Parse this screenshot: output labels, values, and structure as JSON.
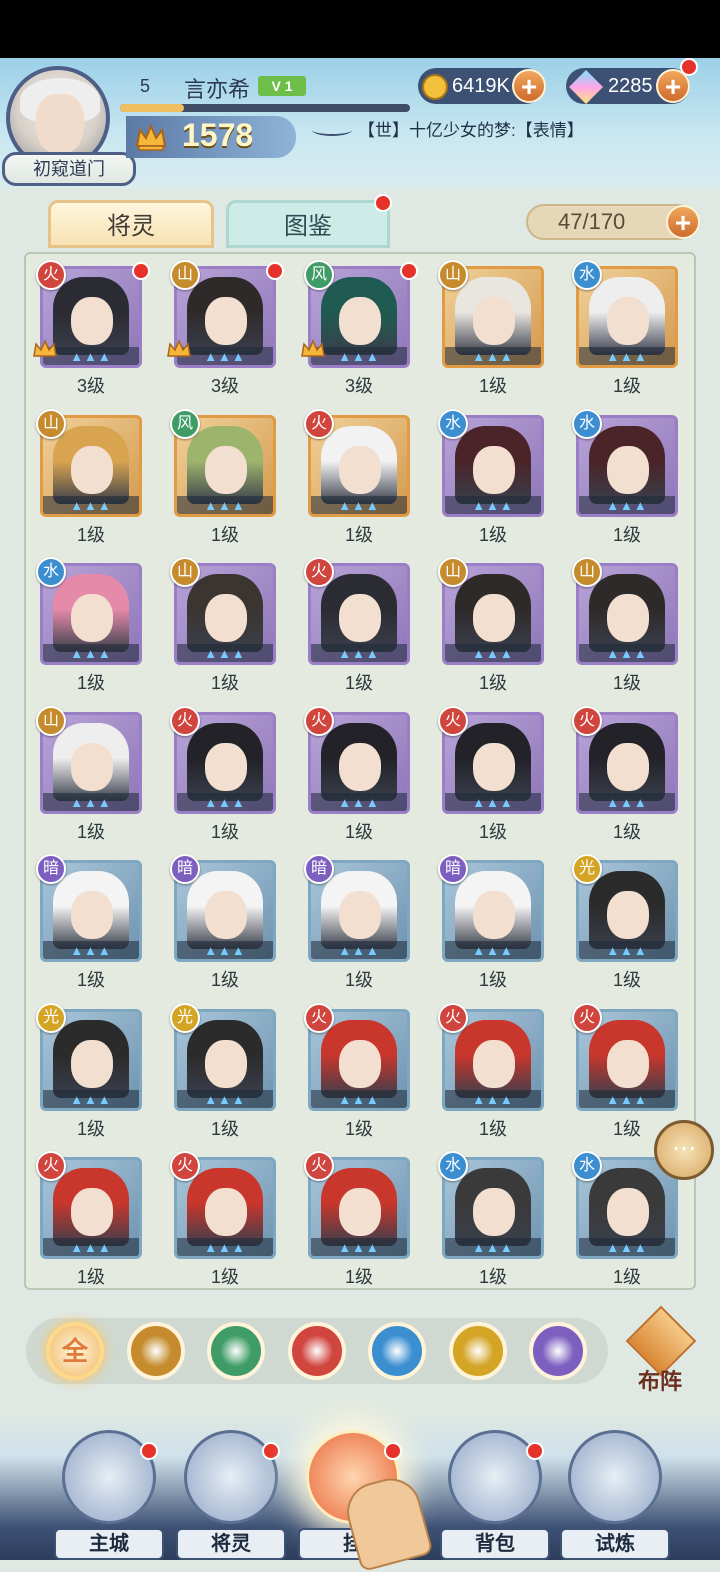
{
  "player": {
    "level": "5",
    "name": "言亦希",
    "vip": "V 1",
    "title": "初窥道门",
    "power": "1578",
    "exp_fraction": 0.22
  },
  "resources": {
    "gold": "6419K",
    "gems": "2285"
  },
  "broadcast": "【世】十亿少女的梦:【表情】",
  "tabs": {
    "heroes": "将灵",
    "codex": "图鉴"
  },
  "hero_count": "47/170",
  "heroes": [
    {
      "level": "3级",
      "element": "fire",
      "frame": "purple",
      "crown": true,
      "dot": true,
      "hair": "#2b2b33"
    },
    {
      "level": "3级",
      "element": "earth",
      "frame": "purple",
      "crown": true,
      "dot": true,
      "hair": "#2f2a2a"
    },
    {
      "level": "3级",
      "element": "wind",
      "frame": "purple",
      "crown": true,
      "dot": true,
      "hair": "#1f5b52"
    },
    {
      "level": "1级",
      "element": "earth",
      "frame": "orange",
      "crown": false,
      "dot": false,
      "hair": "#e9e6df"
    },
    {
      "level": "1级",
      "element": "water",
      "frame": "orange",
      "crown": false,
      "dot": false,
      "hair": "#eeeeee"
    },
    {
      "level": "1级",
      "element": "earth",
      "frame": "orange",
      "crown": false,
      "dot": false,
      "hair": "#d9a450"
    },
    {
      "level": "1级",
      "element": "wind",
      "frame": "orange",
      "crown": false,
      "dot": false,
      "hair": "#9db46c"
    },
    {
      "level": "1级",
      "element": "fire",
      "frame": "orange",
      "crown": false,
      "dot": false,
      "hair": "#f2f2f2"
    },
    {
      "level": "1级",
      "element": "water",
      "frame": "purple",
      "crown": false,
      "dot": false,
      "hair": "#4a2428"
    },
    {
      "level": "1级",
      "element": "water",
      "frame": "purple",
      "crown": false,
      "dot": false,
      "hair": "#4a2428"
    },
    {
      "level": "1级",
      "element": "water",
      "frame": "purple",
      "crown": false,
      "dot": false,
      "hair": "#e58aa8"
    },
    {
      "level": "1级",
      "element": "earth",
      "frame": "purple",
      "crown": false,
      "dot": false,
      "hair": "#3a3530"
    },
    {
      "level": "1级",
      "element": "fire",
      "frame": "purple",
      "crown": false,
      "dot": false,
      "hair": "#2b2b33"
    },
    {
      "level": "1级",
      "element": "earth",
      "frame": "purple",
      "crown": false,
      "dot": false,
      "hair": "#2f2a2a"
    },
    {
      "level": "1级",
      "element": "earth",
      "frame": "purple",
      "crown": false,
      "dot": false,
      "hair": "#2f2a2a"
    },
    {
      "level": "1级",
      "element": "earth",
      "frame": "purple",
      "crown": false,
      "dot": false,
      "hair": "#eeeeee"
    },
    {
      "level": "1级",
      "element": "fire",
      "frame": "purple",
      "crown": false,
      "dot": false,
      "hair": "#222228"
    },
    {
      "level": "1级",
      "element": "fire",
      "frame": "purple",
      "crown": false,
      "dot": false,
      "hair": "#222228"
    },
    {
      "level": "1级",
      "element": "fire",
      "frame": "purple",
      "crown": false,
      "dot": false,
      "hair": "#222228"
    },
    {
      "level": "1级",
      "element": "fire",
      "frame": "purple",
      "crown": false,
      "dot": false,
      "hair": "#222228"
    },
    {
      "level": "1级",
      "element": "dark",
      "frame": "blue",
      "crown": false,
      "dot": false,
      "hair": "#f4f4f4"
    },
    {
      "level": "1级",
      "element": "dark",
      "frame": "blue",
      "crown": false,
      "dot": false,
      "hair": "#f4f4f4"
    },
    {
      "level": "1级",
      "element": "dark",
      "frame": "blue",
      "crown": false,
      "dot": false,
      "hair": "#f4f4f4"
    },
    {
      "level": "1级",
      "element": "dark",
      "frame": "blue",
      "crown": false,
      "dot": false,
      "hair": "#f4f4f4"
    },
    {
      "level": "1级",
      "element": "light",
      "frame": "blue",
      "crown": false,
      "dot": false,
      "hair": "#2b2b2b"
    },
    {
      "level": "1级",
      "element": "light",
      "frame": "blue",
      "crown": false,
      "dot": false,
      "hair": "#2b2b2b"
    },
    {
      "level": "1级",
      "element": "light",
      "frame": "blue",
      "crown": false,
      "dot": false,
      "hair": "#2b2b2b"
    },
    {
      "level": "1级",
      "element": "fire",
      "frame": "blue",
      "crown": false,
      "dot": false,
      "hair": "#c9362c"
    },
    {
      "level": "1级",
      "element": "fire",
      "frame": "blue",
      "crown": false,
      "dot": false,
      "hair": "#c9362c"
    },
    {
      "level": "1级",
      "element": "fire",
      "frame": "blue",
      "crown": false,
      "dot": false,
      "hair": "#c9362c"
    },
    {
      "level": "1级",
      "element": "fire",
      "frame": "blue",
      "crown": false,
      "dot": false,
      "hair": "#c9362c"
    },
    {
      "level": "1级",
      "element": "fire",
      "frame": "blue",
      "crown": false,
      "dot": false,
      "hair": "#c9362c"
    },
    {
      "level": "1级",
      "element": "fire",
      "frame": "blue",
      "crown": false,
      "dot": false,
      "hair": "#c9362c"
    },
    {
      "level": "1级",
      "element": "water",
      "frame": "blue",
      "crown": false,
      "dot": false,
      "hair": "#3a3a3a"
    },
    {
      "level": "1级",
      "element": "water",
      "frame": "blue",
      "crown": false,
      "dot": false,
      "hair": "#3a3a3a"
    }
  ],
  "element_glyphs": {
    "fire": "火",
    "earth": "山",
    "wind": "风",
    "water": "水",
    "light": "光",
    "dark": "暗"
  },
  "filters": [
    {
      "id": "all",
      "label": "全",
      "color": "#f0b866"
    },
    {
      "id": "earth",
      "label": "",
      "color": "#c58b2c"
    },
    {
      "id": "wind",
      "label": "",
      "color": "#3f9c66"
    },
    {
      "id": "fire",
      "label": "",
      "color": "#d0463f"
    },
    {
      "id": "water",
      "label": "",
      "color": "#3b8ed0"
    },
    {
      "id": "light",
      "label": "",
      "color": "#d4a424"
    },
    {
      "id": "dark",
      "label": "",
      "color": "#7c5fbf"
    }
  ],
  "formation_label": "布阵",
  "nav": [
    {
      "label": "主城",
      "dot": true
    },
    {
      "label": "将灵",
      "dot": true
    },
    {
      "label": "挂",
      "dot": true
    },
    {
      "label": "背包",
      "dot": true
    },
    {
      "label": "试炼",
      "dot": false
    }
  ]
}
